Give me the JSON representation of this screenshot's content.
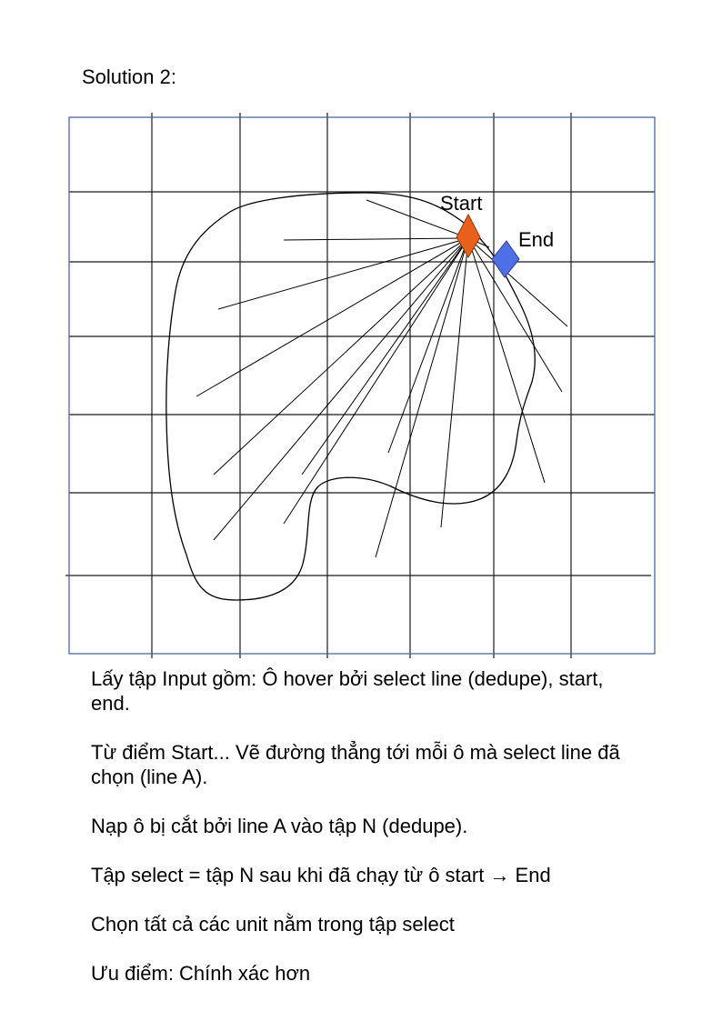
{
  "heading": "Solution 2:",
  "diagram": {
    "start_label": "Start",
    "end_label": "End",
    "colors": {
      "grid": "#1a1a1a",
      "frame": "#3d5a99",
      "start_marker": "#e8601c",
      "end_marker": "#4f6fe6",
      "stroke": "#000000"
    }
  },
  "notes": [
    "Lấy tập Input gồm: Ô hover bởi select line (dedupe), start, end.",
    "Từ điểm Start... Vẽ đường thẳng tới mỗi ô mà select line đã chọn (line A).",
    "Nạp ô bị cắt bởi line A vào tập N (dedupe).",
    "Tập select = tập N sau khi đã chạy từ ô start → End",
    "Chọn tất cả các unit nằm trong tập select",
    "Ưu điểm: Chính xác hơn"
  ]
}
